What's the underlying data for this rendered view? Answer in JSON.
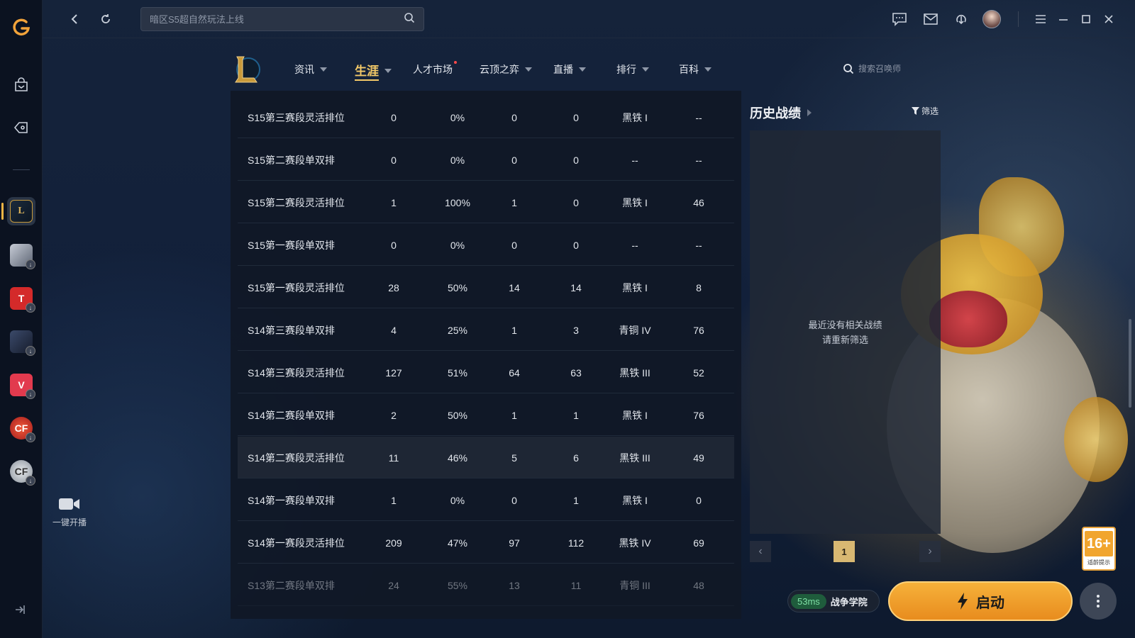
{
  "search": {
    "placeholder": "暗区S5超自然玩法上线"
  },
  "nav": {
    "items": [
      {
        "label": "资讯"
      },
      {
        "label": "生涯"
      },
      {
        "label": "人才市场"
      },
      {
        "label": "云顶之弈"
      },
      {
        "label": "直播"
      },
      {
        "label": "排行"
      },
      {
        "label": "百科"
      }
    ],
    "summoner_search_placeholder": "搜索召唤师"
  },
  "table": {
    "rows": [
      {
        "name": "S15第三赛段灵活排位",
        "games": "0",
        "winrate": "0%",
        "wins": "0",
        "losses": "0",
        "tier": "黑铁 I",
        "lp": "--"
      },
      {
        "name": "S15第二赛段单双排",
        "games": "0",
        "winrate": "0%",
        "wins": "0",
        "losses": "0",
        "tier": "--",
        "lp": "--"
      },
      {
        "name": "S15第二赛段灵活排位",
        "games": "1",
        "winrate": "100%",
        "wins": "1",
        "losses": "0",
        "tier": "黑铁 I",
        "lp": "46"
      },
      {
        "name": "S15第一赛段单双排",
        "games": "0",
        "winrate": "0%",
        "wins": "0",
        "losses": "0",
        "tier": "--",
        "lp": "--"
      },
      {
        "name": "S15第一赛段灵活排位",
        "games": "28",
        "winrate": "50%",
        "wins": "14",
        "losses": "14",
        "tier": "黑铁 I",
        "lp": "8"
      },
      {
        "name": "S14第三赛段单双排",
        "games": "4",
        "winrate": "25%",
        "wins": "1",
        "losses": "3",
        "tier": "青铜 IV",
        "lp": "76"
      },
      {
        "name": "S14第三赛段灵活排位",
        "games": "127",
        "winrate": "51%",
        "wins": "64",
        "losses": "63",
        "tier": "黑铁 III",
        "lp": "52"
      },
      {
        "name": "S14第二赛段单双排",
        "games": "2",
        "winrate": "50%",
        "wins": "1",
        "losses": "1",
        "tier": "黑铁 I",
        "lp": "76"
      },
      {
        "name": "S14第二赛段灵活排位",
        "games": "11",
        "winrate": "46%",
        "wins": "5",
        "losses": "6",
        "tier": "黑铁 III",
        "lp": "49"
      },
      {
        "name": "S14第一赛段单双排",
        "games": "1",
        "winrate": "0%",
        "wins": "0",
        "losses": "1",
        "tier": "黑铁 I",
        "lp": "0"
      },
      {
        "name": "S14第一赛段灵活排位",
        "games": "209",
        "winrate": "47%",
        "wins": "97",
        "losses": "112",
        "tier": "黑铁 IV",
        "lp": "69"
      },
      {
        "name": "S13第二赛段单双排",
        "games": "24",
        "winrate": "55%",
        "wins": "13",
        "losses": "11",
        "tier": "青铜 III",
        "lp": "48"
      }
    ]
  },
  "history": {
    "title": "历史战绩",
    "filter_label": "筛选",
    "empty_line1": "最近没有相关战绩",
    "empty_line2": "请重新筛选",
    "page": "1"
  },
  "sidebar": {
    "live_label": "一键开播"
  },
  "footer": {
    "ping": "53ms",
    "server": "战争学院",
    "launch_label": "启动",
    "age_rating": "16+",
    "age_label": "适龄提示"
  },
  "colors": {
    "accent": "#f3c968",
    "launch": "#f6b13a",
    "ping_green": "#7ee0a5"
  }
}
